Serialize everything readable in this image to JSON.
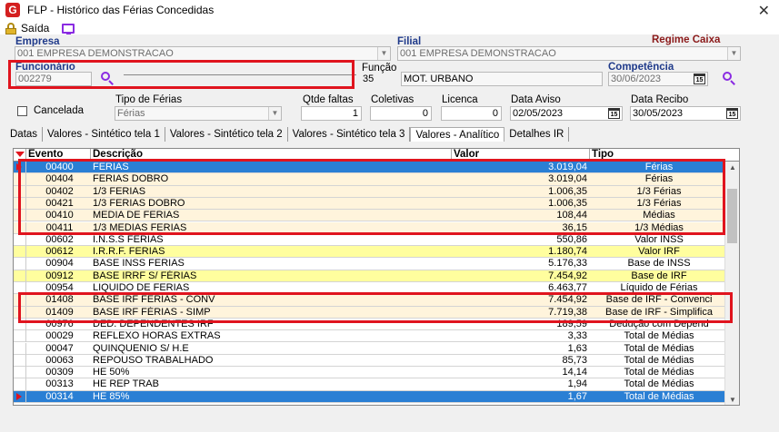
{
  "window": {
    "title": "FLP - Histórico das Férias Concedidas",
    "app_icon": "flp-logo-icon"
  },
  "toolbar": {
    "exit_label": "Saída"
  },
  "empresa": {
    "label": "Empresa",
    "value": "001 EMPRESA DEMONSTRACAO"
  },
  "filial": {
    "label": "Filial",
    "value": "001 EMPRESA DEMONSTRACAO"
  },
  "regime": {
    "label": "Regime Caixa"
  },
  "funcionario": {
    "label": "Funcionário",
    "code": "002279",
    "name": ""
  },
  "funcao": {
    "label": "Função",
    "code": "35",
    "name": "MOT. URBANO"
  },
  "competencia": {
    "label": "Competência",
    "value": "30/06/2023"
  },
  "cancelada": {
    "label": "Cancelada",
    "checked": false
  },
  "tipo_ferias": {
    "label": "Tipo de Férias",
    "value": "Férias"
  },
  "qtde_faltas": {
    "label": "Qtde faltas",
    "value": "1"
  },
  "coletivas": {
    "label": "Coletivas",
    "value": "0"
  },
  "licenca": {
    "label": "Licenca",
    "value": "0"
  },
  "data_aviso": {
    "label": "Data Aviso",
    "value": "02/05/2023"
  },
  "data_recibo": {
    "label": "Data Recibo",
    "value": "30/05/2023"
  },
  "tabs": [
    {
      "label": "Datas",
      "active": false
    },
    {
      "label": "Valores - Sintético tela 1",
      "active": false
    },
    {
      "label": "Valores - Sintético tela 2",
      "active": false
    },
    {
      "label": "Valores - Sintético tela 3",
      "active": false
    },
    {
      "label": "Valores - Analítico",
      "active": true
    },
    {
      "label": "Detalhes IR",
      "active": false
    }
  ],
  "grid": {
    "columns": [
      "Evento",
      "Descrição",
      "Valor",
      "Tipo"
    ],
    "rows": [
      {
        "evento": "00400",
        "descricao": "FERIAS",
        "valor": "3.019,04",
        "tipo": "Férias",
        "style": "sel",
        "marker": true
      },
      {
        "evento": "00404",
        "descricao": "FERIAS DOBRO",
        "valor": "3.019,04",
        "tipo": "Férias",
        "style": "alt",
        "marker": false
      },
      {
        "evento": "00402",
        "descricao": "1/3 FERIAS",
        "valor": "1.006,35",
        "tipo": "1/3 Férias",
        "style": "alt",
        "marker": false
      },
      {
        "evento": "00421",
        "descricao": "1/3 FERIAS DOBRO",
        "valor": "1.006,35",
        "tipo": "1/3 Férias",
        "style": "alt",
        "marker": false
      },
      {
        "evento": "00410",
        "descricao": "MEDIA DE FERIAS",
        "valor": "108,44",
        "tipo": "Médias",
        "style": "alt",
        "marker": false
      },
      {
        "evento": "00411",
        "descricao": "1/3 MEDIAS FERIAS",
        "valor": "36,15",
        "tipo": "1/3 Médias",
        "style": "alt",
        "marker": false
      },
      {
        "evento": "00602",
        "descricao": "I.N.S.S FERIAS",
        "valor": "550,86",
        "tipo": "Valor INSS",
        "style": "plain",
        "marker": false
      },
      {
        "evento": "00612",
        "descricao": "I.R.R.F. FERIAS",
        "valor": "1.180,74",
        "tipo": "Valor IRF",
        "style": "yellow",
        "marker": false
      },
      {
        "evento": "00904",
        "descricao": "BASE INSS FERIAS",
        "valor": "5.176,33",
        "tipo": "Base de INSS",
        "style": "plain",
        "marker": false
      },
      {
        "evento": "00912",
        "descricao": "BASE IRRF S/ FÉRIAS",
        "valor": "7.454,92",
        "tipo": "Base de IRF",
        "style": "yellow",
        "marker": false
      },
      {
        "evento": "00954",
        "descricao": "LIQUIDO DE FERIAS",
        "valor": "6.463,77",
        "tipo": "Líquido de Férias",
        "style": "plain",
        "marker": false
      },
      {
        "evento": "01408",
        "descricao": "BASE IRF FÉRIAS - CONV",
        "valor": "7.454,92",
        "tipo": "Base de IRF - Convenci",
        "style": "alt",
        "marker": false
      },
      {
        "evento": "01409",
        "descricao": "BASE IRF FÉRIAS - SIMP",
        "valor": "7.719,38",
        "tipo": "Base de IRF - Simplifica",
        "style": "alt",
        "marker": false
      },
      {
        "evento": "00976",
        "descricao": "DED. DEPENDENTES IRF",
        "valor": "189,59",
        "tipo": "Dedução com Depend",
        "style": "plain",
        "marker": false
      },
      {
        "evento": "00029",
        "descricao": "REFLEXO HORAS EXTRAS",
        "valor": "3,33",
        "tipo": "Total de Médias",
        "style": "plain",
        "marker": false
      },
      {
        "evento": "00047",
        "descricao": "QUINQUENIO S/ H.E",
        "valor": "1,63",
        "tipo": "Total de Médias",
        "style": "plain",
        "marker": false
      },
      {
        "evento": "00063",
        "descricao": "REPOUSO TRABALHADO",
        "valor": "85,73",
        "tipo": "Total de Médias",
        "style": "plain",
        "marker": false
      },
      {
        "evento": "00309",
        "descricao": "HE 50%",
        "valor": "14,14",
        "tipo": "Total de Médias",
        "style": "plain",
        "marker": false
      },
      {
        "evento": "00313",
        "descricao": "HE REP TRAB",
        "valor": "1,94",
        "tipo": "Total de Médias",
        "style": "plain",
        "marker": false
      },
      {
        "evento": "00314",
        "descricao": "HE 85%",
        "valor": "1,67",
        "tipo": "Total de Médias",
        "style": "sel",
        "marker": true
      }
    ]
  },
  "colors": {
    "accent": "#2a7fd4",
    "highlight_box": "#e0141e",
    "label_blue": "#1f3a8a",
    "label_red": "#8b1a1a",
    "yellow_row": "#fffe9e"
  }
}
